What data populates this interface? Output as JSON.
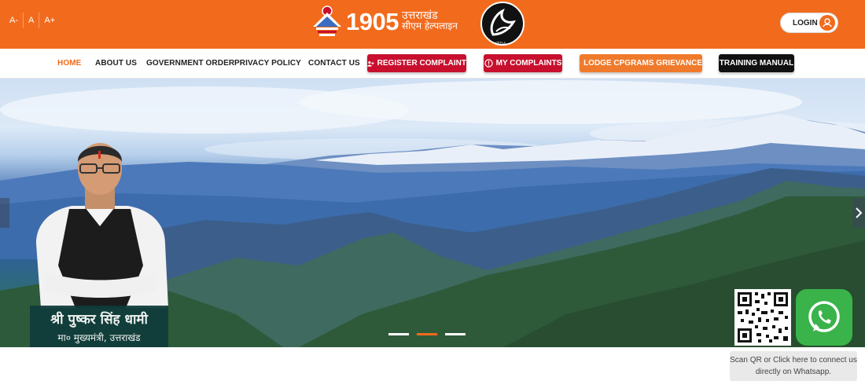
{
  "header": {
    "font_controls": [
      "A-",
      "A",
      "A+"
    ],
    "brand_number": "1905",
    "brand_hindi_line1": "उत्तराखंड",
    "brand_hindi_line2": "सीएम हेल्पलाइन",
    "partner_logo_text": "ITDA",
    "login_label": "LOGIN"
  },
  "nav": {
    "links": [
      {
        "label": "HOME",
        "active": true
      },
      {
        "label": "ABOUT US"
      },
      {
        "label": "GOVERNMENT ORDER"
      },
      {
        "label": "PRIVACY POLICY"
      },
      {
        "label": "CONTACT US"
      }
    ],
    "buttons": [
      {
        "label": "REGISTER COMPLAINT",
        "icon": "user-add-icon",
        "color": "#c8102e"
      },
      {
        "label": "MY COMPLAINTS",
        "icon": "alert-circle-icon",
        "color": "#c8102e"
      },
      {
        "label": "LODGE CPGRAMS GRIEVANCE",
        "icon": "user-badge-icon",
        "color": "#f07a2b"
      },
      {
        "label": "TRAINING MANUAL",
        "icon": "",
        "color": "#111111"
      }
    ]
  },
  "hero": {
    "caption_name": "श्री पुष्कर सिंह धामी",
    "caption_title": "मा० मुख्यमंत्री, उत्तराखंड",
    "slides": 3,
    "active_slide": 2
  },
  "whatsapp": {
    "note": "Scan QR or Click here to connect us directly on Whatsapp."
  },
  "colors": {
    "primary": "#f26b1d",
    "danger": "#c8102e",
    "whatsapp": "#39b34a"
  }
}
